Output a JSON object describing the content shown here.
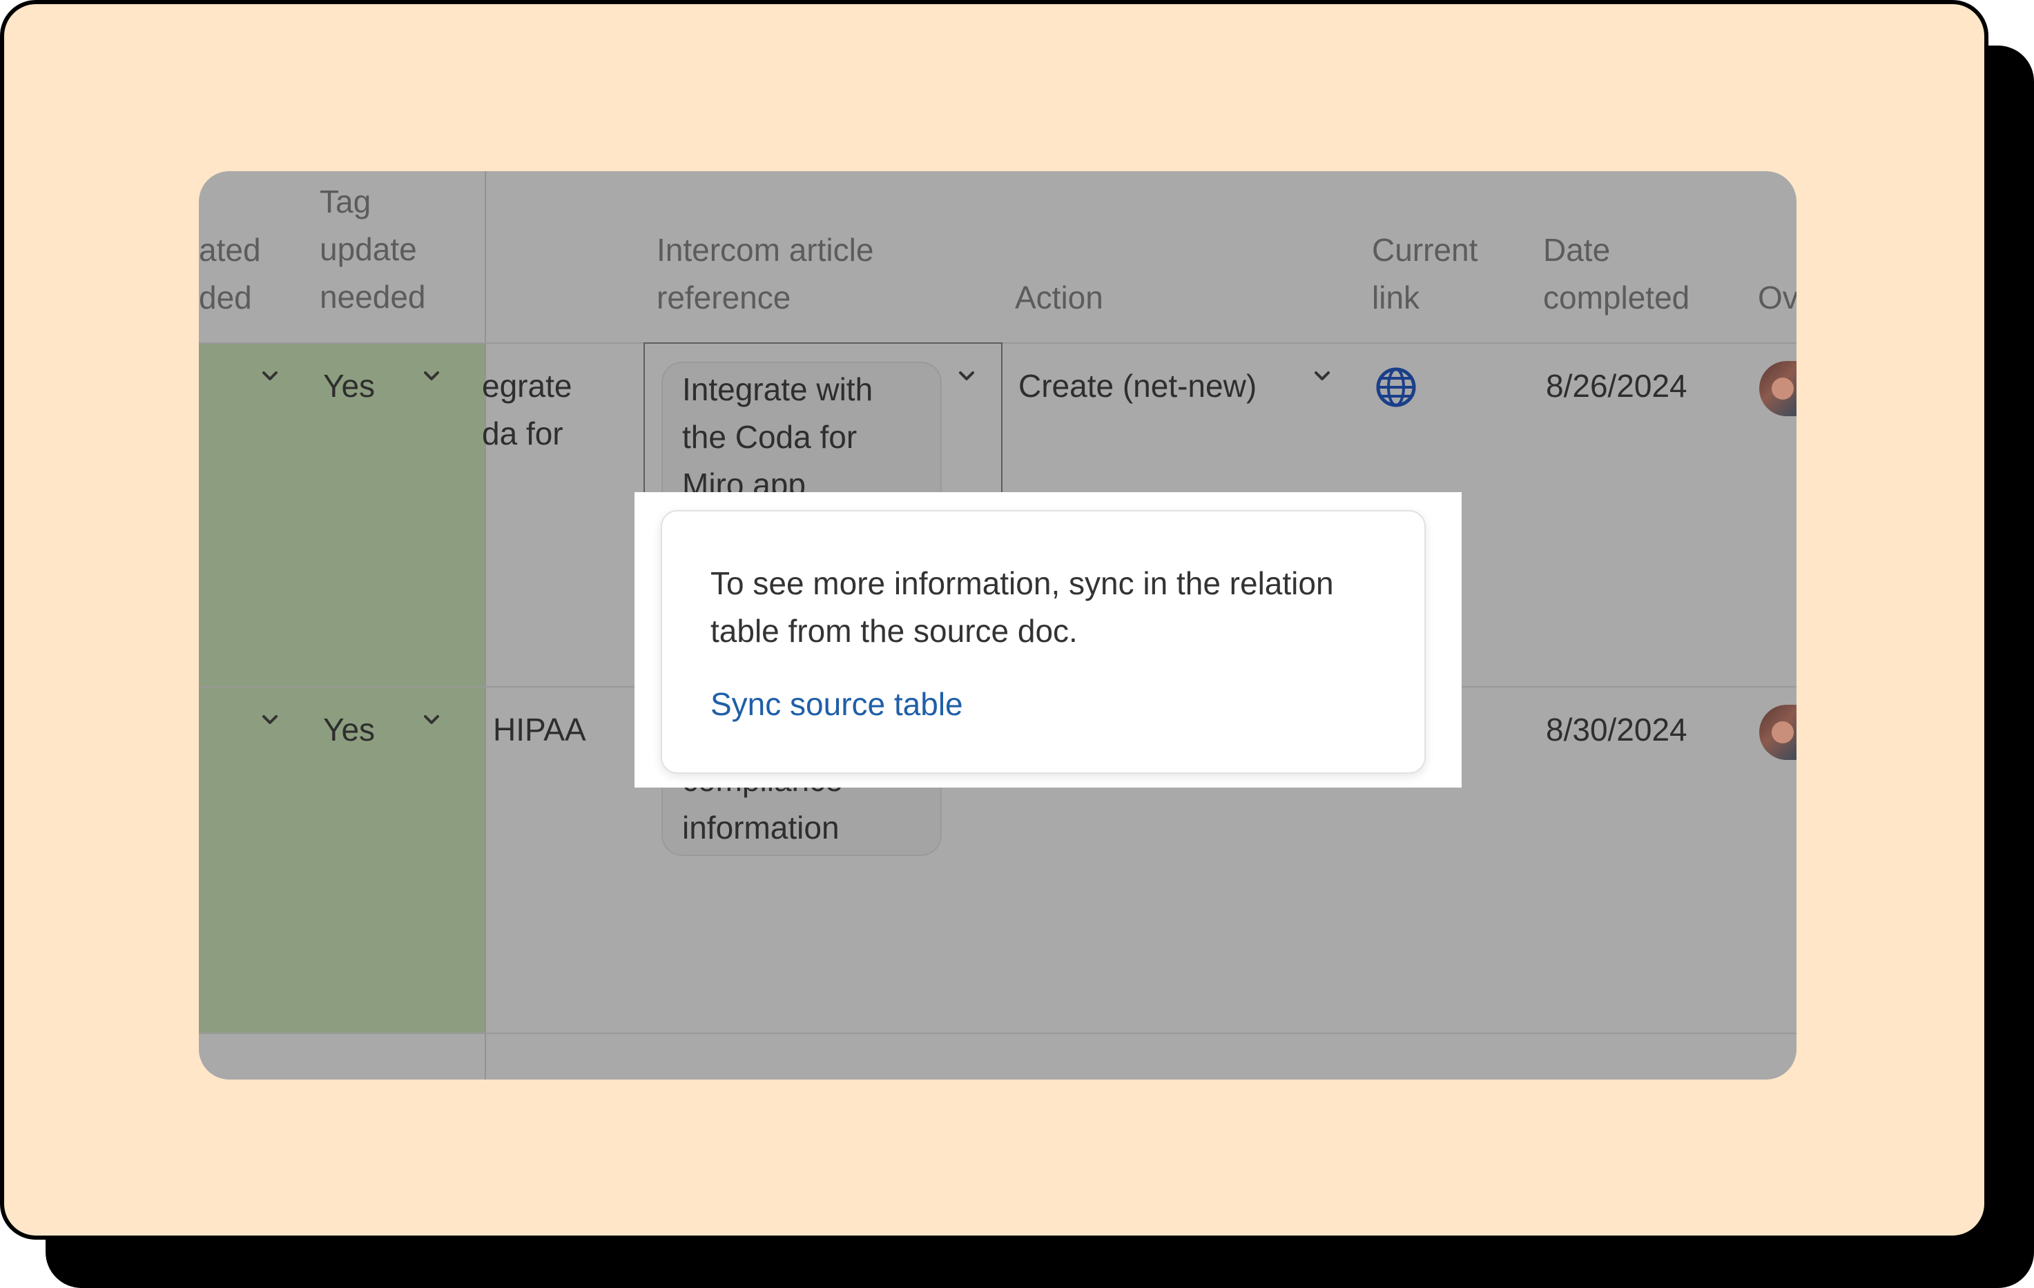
{
  "headers": {
    "col_a": [
      "ated",
      "ded"
    ],
    "col_tag": [
      "Tag",
      "update",
      "needed"
    ],
    "col_intercom": [
      "Intercom article",
      "reference"
    ],
    "col_action": "Action",
    "col_link": [
      "Current",
      "link"
    ],
    "col_date": [
      "Date",
      "completed"
    ],
    "col_owner": "Ov"
  },
  "rows": [
    {
      "tag": "Yes",
      "title_fragment": [
        "egrate",
        "da for"
      ],
      "intercom_chip": [
        "Integrate with",
        "the Coda for",
        "Miro app"
      ],
      "action": "Create (net-new)",
      "link_icon": "globe-icon",
      "date": "8/26/2024"
    },
    {
      "tag": "Yes",
      "title_fragment": [
        "HIPAA"
      ],
      "intercom_chip": [
        "compliance",
        "information"
      ],
      "date": "8/30/2024"
    }
  ],
  "popup": {
    "message": "To see more information, sync in the relation table from the source doc.",
    "link_label": "Sync source table"
  },
  "colors": {
    "background": "#ffe6c8",
    "table_overlay": "#a9a9a9",
    "highlighted_column": "#8d9e80",
    "link": "#1f5fa8",
    "globe": "#1a3f8a"
  }
}
